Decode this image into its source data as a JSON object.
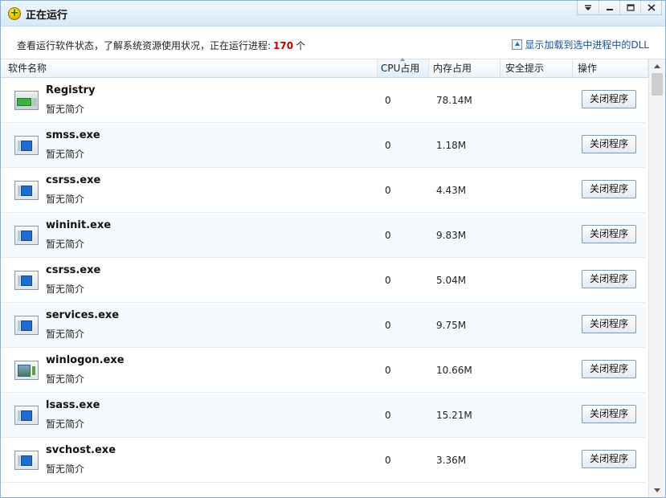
{
  "window": {
    "title": "正在运行",
    "controls": [
      "chevron-down-icon",
      "minimize-icon",
      "maximize-icon",
      "close-icon"
    ]
  },
  "info": {
    "prefix": "查看运行软件状态，了解系统资源使用状况，正在运行进程:",
    "count": "170",
    "suffix": "个",
    "dll_link": "显示加载到选中进程中的DLL"
  },
  "columns": {
    "name": "软件名称",
    "cpu": "CPU占用",
    "memory": "内存占用",
    "security": "安全提示",
    "action": "操作"
  },
  "processes": [
    {
      "name": "Registry",
      "desc": "暂无简介",
      "cpu": "0",
      "memory": "78.14M",
      "action": "关闭程序",
      "icon": "registry-icon"
    },
    {
      "name": "smss.exe",
      "desc": "暂无简介",
      "cpu": "0",
      "memory": "1.18M",
      "action": "关闭程序",
      "icon": "process-window-icon"
    },
    {
      "name": "csrss.exe",
      "desc": "暂无简介",
      "cpu": "0",
      "memory": "4.43M",
      "action": "关闭程序",
      "icon": "process-window-icon"
    },
    {
      "name": "wininit.exe",
      "desc": "暂无简介",
      "cpu": "0",
      "memory": "9.83M",
      "action": "关闭程序",
      "icon": "process-window-icon"
    },
    {
      "name": "csrss.exe",
      "desc": "暂无简介",
      "cpu": "0",
      "memory": "5.04M",
      "action": "关闭程序",
      "icon": "process-window-icon"
    },
    {
      "name": "services.exe",
      "desc": "暂无简介",
      "cpu": "0",
      "memory": "9.75M",
      "action": "关闭程序",
      "icon": "process-window-icon"
    },
    {
      "name": "winlogon.exe",
      "desc": "暂无简介",
      "cpu": "0",
      "memory": "10.66M",
      "action": "关闭程序",
      "icon": "winlogon-icon"
    },
    {
      "name": "lsass.exe",
      "desc": "暂无简介",
      "cpu": "0",
      "memory": "15.21M",
      "action": "关闭程序",
      "icon": "process-window-icon"
    },
    {
      "name": "svchost.exe",
      "desc": "暂无简介",
      "cpu": "0",
      "memory": "3.36M",
      "action": "关闭程序",
      "icon": "process-window-icon"
    }
  ],
  "colors": {
    "count": "#c00000",
    "link": "#1b4f9c",
    "title_bar": "#d9e9f7"
  }
}
